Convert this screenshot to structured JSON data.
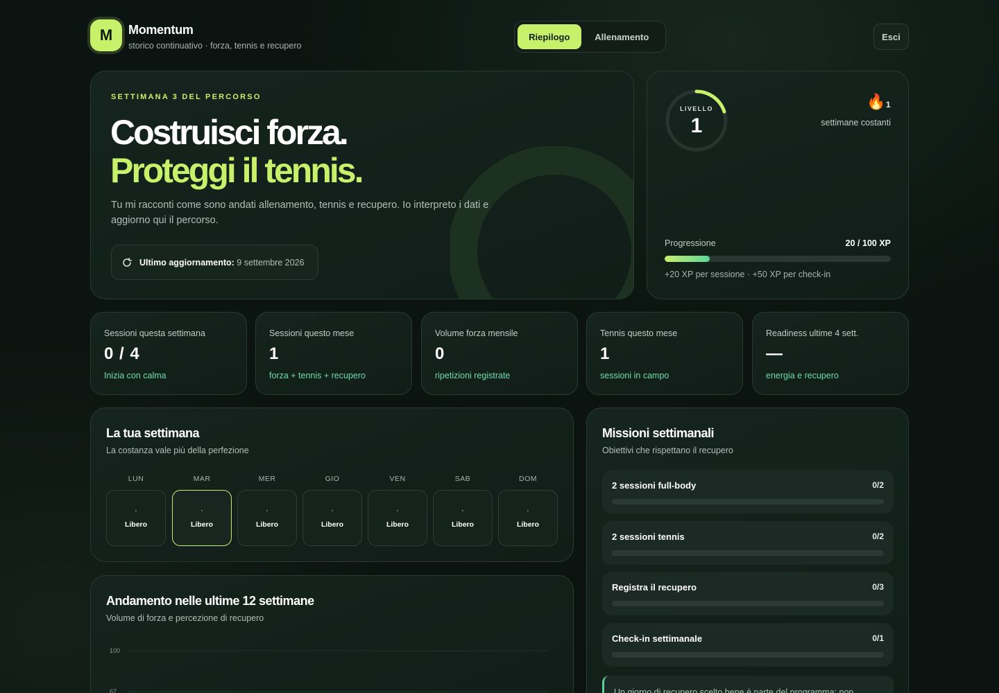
{
  "app": {
    "logo_letter": "M",
    "name": "Momentum",
    "subtitle": "storico continuativo · forza, tennis e recupero"
  },
  "nav": {
    "tabs": [
      {
        "label": "Riepilogo",
        "active": true
      },
      {
        "label": "Allenamento",
        "active": false
      }
    ],
    "logout_label": "Esci"
  },
  "hero": {
    "eyebrow": "SETTIMANA 3 DEL PERCORSO",
    "headline_1": "Costruisci forza.",
    "headline_2": "Proteggi il tennis.",
    "description": "Tu mi racconti come sono andati allenamento, tennis e recupero. Io interpreto i dati e aggiorno qui il percorso.",
    "update_label": "Ultimo aggiornamento:",
    "update_value": "9 settembre 2026",
    "update_icon": "refresh-icon"
  },
  "level": {
    "label": "LIVELLO",
    "value": "1",
    "ring_progress": 0.2,
    "streak_icon": "🔥",
    "streak_count": "1",
    "streak_label": "settimane costanti",
    "progress_label": "Progressione",
    "progress_value": "20 / 100 XP",
    "progress_fraction": 0.2,
    "progress_note": "+20 XP per sessione · +50 XP per check-in"
  },
  "stats": [
    {
      "label": "Sessioni questa settimana",
      "value": "0 / 4",
      "note": "Inizia con calma"
    },
    {
      "label": "Sessioni questo mese",
      "value": "1",
      "note": "forza + tennis + recupero"
    },
    {
      "label": "Volume forza mensile",
      "value": "0",
      "note": "ripetizioni registrate"
    },
    {
      "label": "Tennis questo mese",
      "value": "1",
      "note": "sessioni in campo"
    },
    {
      "label": "Readiness ultime 4 sett.",
      "value": "—",
      "note": "energia e recupero"
    }
  ],
  "week": {
    "title": "La tua settimana",
    "subtitle": "La costanza vale più della perfezione",
    "days": [
      {
        "name": "LUN",
        "dot": "·",
        "state": "Libero",
        "today": false
      },
      {
        "name": "MAR",
        "dot": "·",
        "state": "Libero",
        "today": true
      },
      {
        "name": "MER",
        "dot": "·",
        "state": "Libero",
        "today": false
      },
      {
        "name": "GIO",
        "dot": "·",
        "state": "Libero",
        "today": false
      },
      {
        "name": "VEN",
        "dot": "·",
        "state": "Libero",
        "today": false
      },
      {
        "name": "SAB",
        "dot": "·",
        "state": "Libero",
        "today": false
      },
      {
        "name": "DOM",
        "dot": "·",
        "state": "Libero",
        "today": false
      }
    ]
  },
  "trend": {
    "title": "Andamento nelle ultime 12 settimane",
    "subtitle": "Volume di forza e percezione di recupero",
    "y_ticks": [
      "100",
      "67"
    ]
  },
  "missions": {
    "title": "Missioni settimanali",
    "subtitle": "Obiettivi che rispettano il recupero",
    "items": [
      {
        "name": "2 sessioni full-body",
        "count": "0/2",
        "fraction": 0
      },
      {
        "name": "2 sessioni tennis",
        "count": "0/2",
        "fraction": 0
      },
      {
        "name": "Registra il recupero",
        "count": "0/3",
        "fraction": 0
      },
      {
        "name": "Check-in settimanale",
        "count": "0/1",
        "fraction": 0
      }
    ],
    "tip": "Un giorno di recupero scelto bene è parte del programma: non"
  },
  "colors": {
    "accent": "#c7f06b",
    "mint": "#5fd39a",
    "background": "#0b1410",
    "card": "#15241e"
  }
}
